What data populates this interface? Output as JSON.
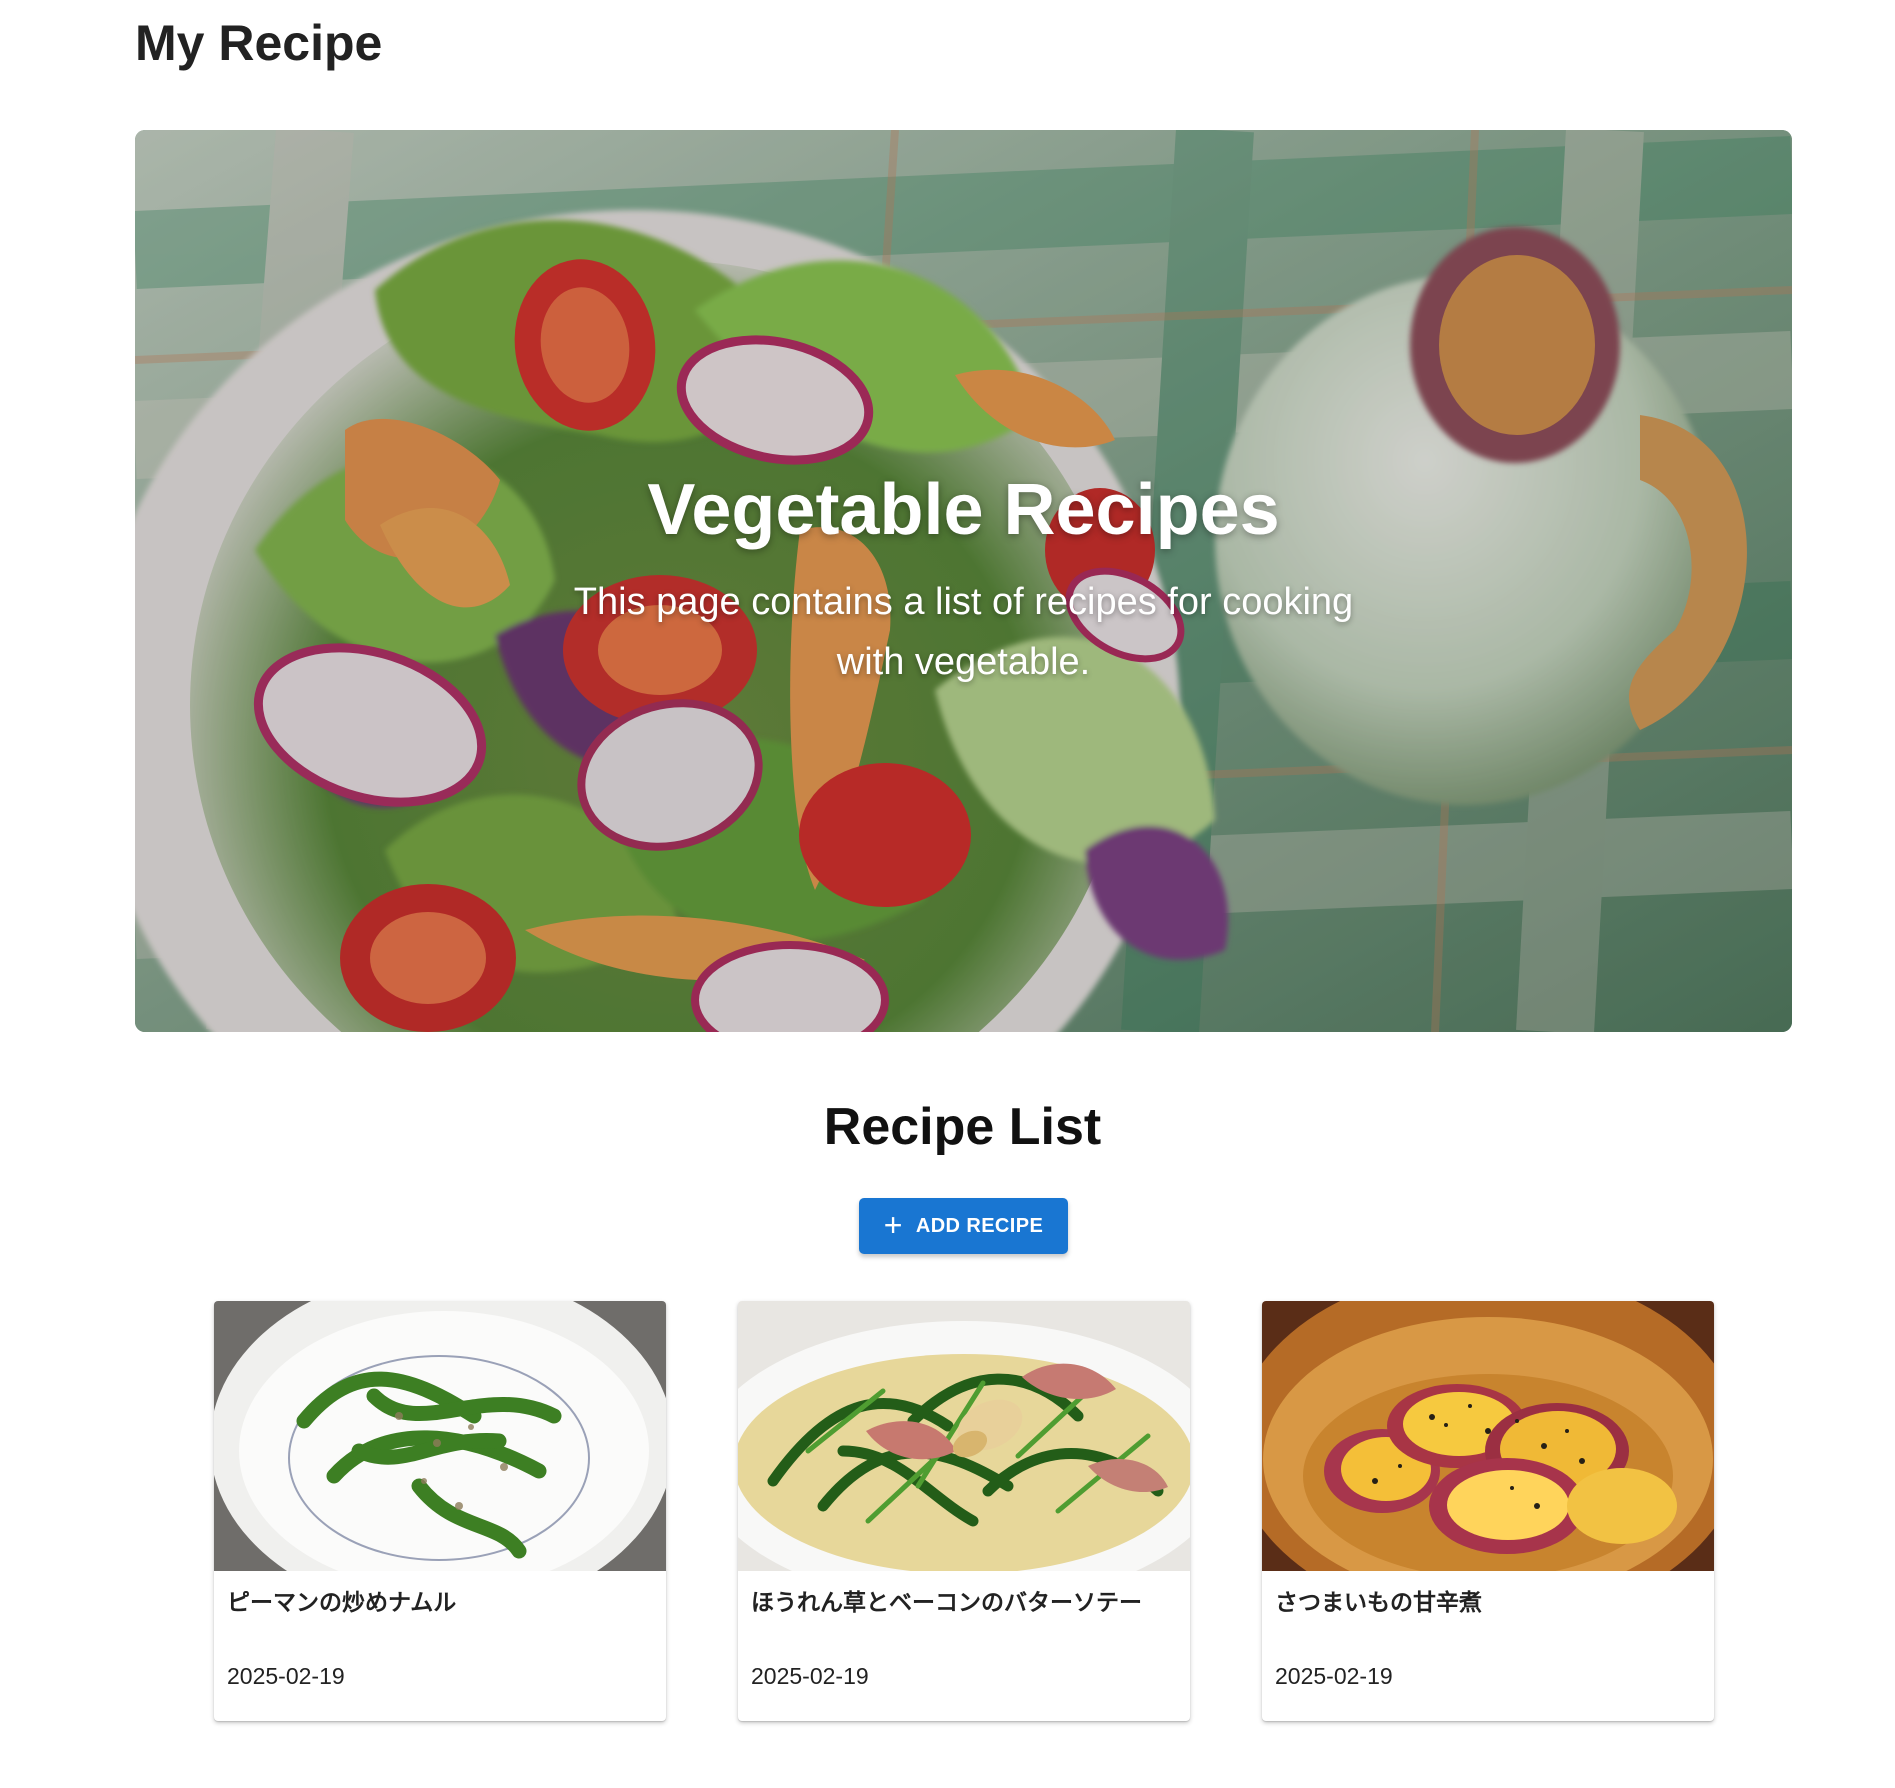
{
  "app": {
    "title": "My Recipe"
  },
  "hero": {
    "title": "Vegetable Recipes",
    "subtitle": "This page contains a list of recipes for cooking with vegetable."
  },
  "recipe_list": {
    "heading": "Recipe List",
    "add_button_label": "ADD RECIPE",
    "add_button_icon": "plus-icon",
    "accent_color": "#1976d2",
    "cards": [
      {
        "title": "ピーマンの炒めナムル",
        "date": "2025-02-19",
        "image_alt": "stir-fried green peppers namul on white plate"
      },
      {
        "title": "ほうれん草とベーコンのバターソテー",
        "date": "2025-02-19",
        "image_alt": "spinach and bacon butter sauté"
      },
      {
        "title": "さつまいもの甘辛煮",
        "date": "2025-02-19",
        "image_alt": "sweet and spicy simmered sweet potato"
      }
    ]
  }
}
